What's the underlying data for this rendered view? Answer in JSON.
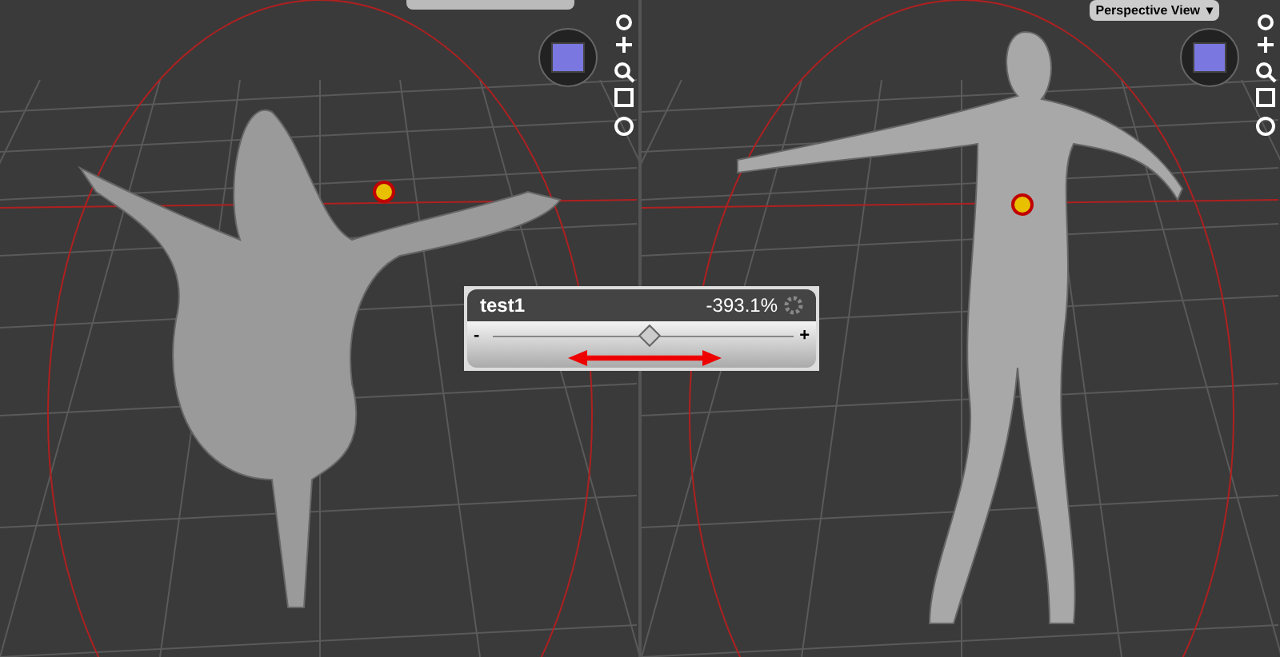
{
  "camera_menu": {
    "label": "Perspective View",
    "caret": "▾"
  },
  "slider": {
    "label": "test1",
    "reading": "-393.1%",
    "minus": "-",
    "plus": "+",
    "level": 0.52
  }
}
